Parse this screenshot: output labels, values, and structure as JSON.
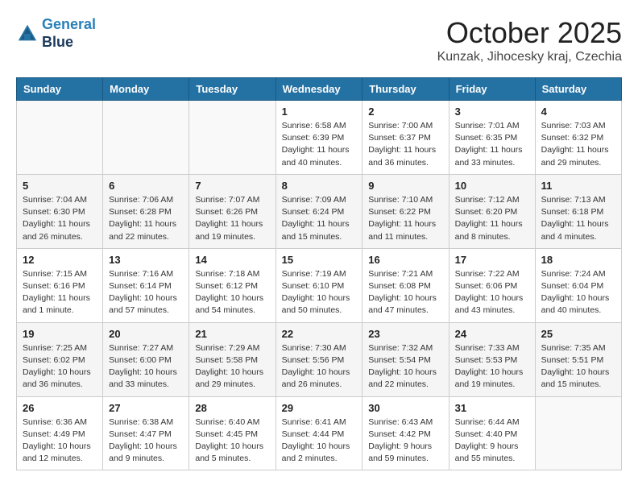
{
  "header": {
    "logo_line1": "General",
    "logo_line2": "Blue",
    "month_title": "October 2025",
    "location": "Kunzak, Jihocesky kraj, Czechia"
  },
  "weekdays": [
    "Sunday",
    "Monday",
    "Tuesday",
    "Wednesday",
    "Thursday",
    "Friday",
    "Saturday"
  ],
  "weeks": [
    [
      {
        "day": "",
        "info": ""
      },
      {
        "day": "",
        "info": ""
      },
      {
        "day": "",
        "info": ""
      },
      {
        "day": "1",
        "info": "Sunrise: 6:58 AM\nSunset: 6:39 PM\nDaylight: 11 hours\nand 40 minutes."
      },
      {
        "day": "2",
        "info": "Sunrise: 7:00 AM\nSunset: 6:37 PM\nDaylight: 11 hours\nand 36 minutes."
      },
      {
        "day": "3",
        "info": "Sunrise: 7:01 AM\nSunset: 6:35 PM\nDaylight: 11 hours\nand 33 minutes."
      },
      {
        "day": "4",
        "info": "Sunrise: 7:03 AM\nSunset: 6:32 PM\nDaylight: 11 hours\nand 29 minutes."
      }
    ],
    [
      {
        "day": "5",
        "info": "Sunrise: 7:04 AM\nSunset: 6:30 PM\nDaylight: 11 hours\nand 26 minutes."
      },
      {
        "day": "6",
        "info": "Sunrise: 7:06 AM\nSunset: 6:28 PM\nDaylight: 11 hours\nand 22 minutes."
      },
      {
        "day": "7",
        "info": "Sunrise: 7:07 AM\nSunset: 6:26 PM\nDaylight: 11 hours\nand 19 minutes."
      },
      {
        "day": "8",
        "info": "Sunrise: 7:09 AM\nSunset: 6:24 PM\nDaylight: 11 hours\nand 15 minutes."
      },
      {
        "day": "9",
        "info": "Sunrise: 7:10 AM\nSunset: 6:22 PM\nDaylight: 11 hours\nand 11 minutes."
      },
      {
        "day": "10",
        "info": "Sunrise: 7:12 AM\nSunset: 6:20 PM\nDaylight: 11 hours\nand 8 minutes."
      },
      {
        "day": "11",
        "info": "Sunrise: 7:13 AM\nSunset: 6:18 PM\nDaylight: 11 hours\nand 4 minutes."
      }
    ],
    [
      {
        "day": "12",
        "info": "Sunrise: 7:15 AM\nSunset: 6:16 PM\nDaylight: 11 hours\nand 1 minute."
      },
      {
        "day": "13",
        "info": "Sunrise: 7:16 AM\nSunset: 6:14 PM\nDaylight: 10 hours\nand 57 minutes."
      },
      {
        "day": "14",
        "info": "Sunrise: 7:18 AM\nSunset: 6:12 PM\nDaylight: 10 hours\nand 54 minutes."
      },
      {
        "day": "15",
        "info": "Sunrise: 7:19 AM\nSunset: 6:10 PM\nDaylight: 10 hours\nand 50 minutes."
      },
      {
        "day": "16",
        "info": "Sunrise: 7:21 AM\nSunset: 6:08 PM\nDaylight: 10 hours\nand 47 minutes."
      },
      {
        "day": "17",
        "info": "Sunrise: 7:22 AM\nSunset: 6:06 PM\nDaylight: 10 hours\nand 43 minutes."
      },
      {
        "day": "18",
        "info": "Sunrise: 7:24 AM\nSunset: 6:04 PM\nDaylight: 10 hours\nand 40 minutes."
      }
    ],
    [
      {
        "day": "19",
        "info": "Sunrise: 7:25 AM\nSunset: 6:02 PM\nDaylight: 10 hours\nand 36 minutes."
      },
      {
        "day": "20",
        "info": "Sunrise: 7:27 AM\nSunset: 6:00 PM\nDaylight: 10 hours\nand 33 minutes."
      },
      {
        "day": "21",
        "info": "Sunrise: 7:29 AM\nSunset: 5:58 PM\nDaylight: 10 hours\nand 29 minutes."
      },
      {
        "day": "22",
        "info": "Sunrise: 7:30 AM\nSunset: 5:56 PM\nDaylight: 10 hours\nand 26 minutes."
      },
      {
        "day": "23",
        "info": "Sunrise: 7:32 AM\nSunset: 5:54 PM\nDaylight: 10 hours\nand 22 minutes."
      },
      {
        "day": "24",
        "info": "Sunrise: 7:33 AM\nSunset: 5:53 PM\nDaylight: 10 hours\nand 19 minutes."
      },
      {
        "day": "25",
        "info": "Sunrise: 7:35 AM\nSunset: 5:51 PM\nDaylight: 10 hours\nand 15 minutes."
      }
    ],
    [
      {
        "day": "26",
        "info": "Sunrise: 6:36 AM\nSunset: 4:49 PM\nDaylight: 10 hours\nand 12 minutes."
      },
      {
        "day": "27",
        "info": "Sunrise: 6:38 AM\nSunset: 4:47 PM\nDaylight: 10 hours\nand 9 minutes."
      },
      {
        "day": "28",
        "info": "Sunrise: 6:40 AM\nSunset: 4:45 PM\nDaylight: 10 hours\nand 5 minutes."
      },
      {
        "day": "29",
        "info": "Sunrise: 6:41 AM\nSunset: 4:44 PM\nDaylight: 10 hours\nand 2 minutes."
      },
      {
        "day": "30",
        "info": "Sunrise: 6:43 AM\nSunset: 4:42 PM\nDaylight: 9 hours\nand 59 minutes."
      },
      {
        "day": "31",
        "info": "Sunrise: 6:44 AM\nSunset: 4:40 PM\nDaylight: 9 hours\nand 55 minutes."
      },
      {
        "day": "",
        "info": ""
      }
    ]
  ]
}
